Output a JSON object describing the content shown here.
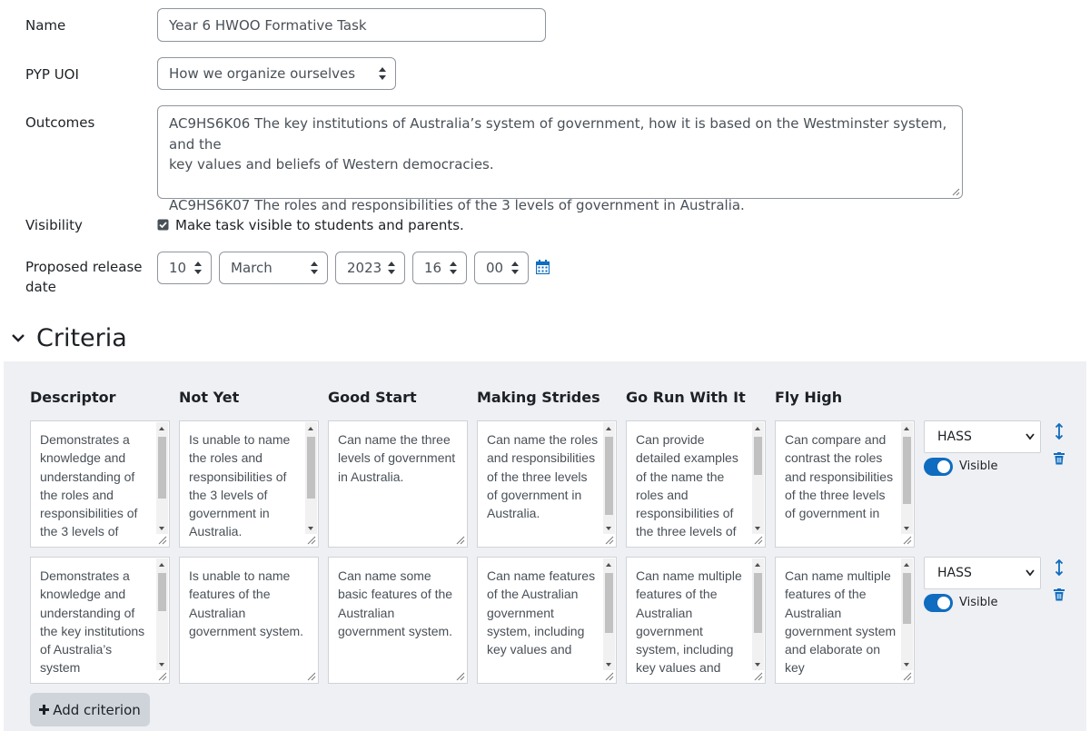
{
  "form": {
    "name_label": "Name",
    "name_value": "Year 6 HWOO Formative Task",
    "uoi_label": "PYP UOI",
    "uoi_value": "How we organize ourselves",
    "outcomes_label": "Outcomes",
    "outcomes_line1": "AC9HS6K06 The key institutions of Australia’s system of government, how it is based on the Westminster system, and the",
    "outcomes_line2": "key values and beliefs of Western democracies.",
    "outcomes_line3": "AC9HS6K07 The roles and responsibilities of the 3 levels of government in Australia.",
    "visibility_label": "Visibility",
    "visibility_checked": true,
    "visibility_text": "Make task visible to students and parents.",
    "release_label_line1": "Proposed release",
    "release_label_line2": "date",
    "release_day": "10",
    "release_month": "March",
    "release_year": "2023",
    "release_hour": "16",
    "release_minute": "00"
  },
  "criteria": {
    "title": "Criteria",
    "columns": [
      "Descriptor",
      "Not Yet",
      "Good Start",
      "Making Strides",
      "Go Run With It",
      "Fly High"
    ],
    "rows": [
      {
        "cells": [
          "Demonstrates a knowledge and understanding of the roles and responsibilities of the 3 levels of",
          "Is unable to name the roles and responsibilities of the 3 levels of government in Australia.",
          "Can name the three levels of government in Australia.",
          "Can name the roles and responsibilities of the three levels of government in Australia.",
          "Can provide detailed examples of the name the roles and responsibilities of the three levels of",
          "Can compare and contrast the roles and responsibilities of the three levels of government in"
        ],
        "strand": "HASS",
        "visible_label": "Visible"
      },
      {
        "cells": [
          "Demonstrates a knowledge and understanding of the key institutions of Australia’s system",
          "Is unable to name features of the Australian government system.",
          "Can name some basic features of the Australian government system.",
          "Can name features of the Australian government system, including key values and",
          "Can name multiple features of the Australian government system, including key values and",
          "Can name multiple features of the Australian government system and elaborate on key"
        ],
        "strand": "HASS",
        "visible_label": "Visible"
      }
    ],
    "add_label": "Add criterion"
  }
}
